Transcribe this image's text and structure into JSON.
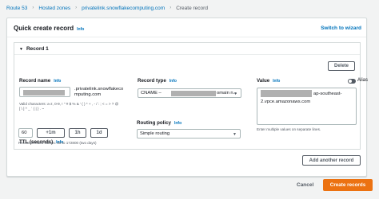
{
  "breadcrumb": {
    "items": [
      "Route 53",
      "Hosted zones",
      "privatelink.snowflakecomputing.com"
    ],
    "current": "Create record",
    "separator": "›"
  },
  "header": {
    "title": "Quick create record",
    "info": "Info",
    "switch_label": "Switch to wizard"
  },
  "record": {
    "title": "Record 1",
    "delete_label": "Delete",
    "record_name": {
      "label": "Record name",
      "info": "Info",
      "suffix_line1": ".privatelink.snowflakeco",
      "suffix_line2": "mputing.com",
      "hint_line1": "Valid characters: a-z, 0-9, ! \" # $ % & ' ( ) * + , - / : ; < = > ? @",
      "hint_line2": "[ \\ ] ^ _ ` { | } . ~"
    },
    "record_type": {
      "label": "Record type",
      "info": "Info",
      "value_prefix": "CNAME –",
      "value_suffix": "omain n..."
    },
    "value": {
      "label": "Value",
      "info": "Info",
      "alias_label": "Alias",
      "line1_suffix": "ap-southeast-",
      "line2": "2.vpce.amazonaws.com",
      "hint": "Enter multiple values on separate lines."
    },
    "ttl": {
      "label": "TTL (seconds)",
      "info": "Info",
      "value": "60",
      "buttons": [
        "+1m",
        "1h",
        "1d"
      ],
      "hint": "Recommended values: 60 to 172800 (two days)"
    },
    "routing": {
      "label": "Routing policy",
      "info": "Info",
      "value": "Simple routing"
    }
  },
  "actions": {
    "add_label": "Add another record",
    "cancel_label": "Cancel",
    "create_label": "Create records"
  },
  "colors": {
    "link": "#0073bb",
    "primary": "#ec7211",
    "border": "#aab7b8"
  }
}
